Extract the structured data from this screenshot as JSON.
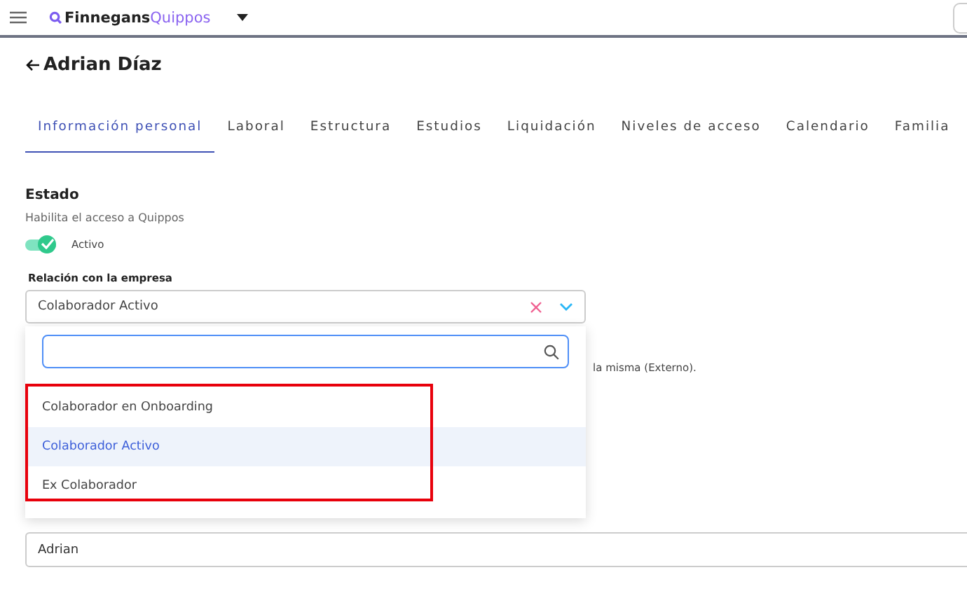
{
  "header": {
    "brand_primary": "Finnegans",
    "brand_secondary": "Quippos"
  },
  "page": {
    "title": "Adrian Díaz"
  },
  "tabs": [
    {
      "label": "Información personal",
      "selected": true
    },
    {
      "label": "Laboral",
      "selected": false
    },
    {
      "label": "Estructura",
      "selected": false
    },
    {
      "label": "Estudios",
      "selected": false
    },
    {
      "label": "Liquidación",
      "selected": false
    },
    {
      "label": "Niveles de acceso",
      "selected": false
    },
    {
      "label": "Calendario",
      "selected": false
    },
    {
      "label": "Familia",
      "selected": false
    }
  ],
  "estado": {
    "heading": "Estado",
    "helper": "Habilita el acceso a Quippos",
    "toggle": {
      "label": "Activo",
      "on": true
    }
  },
  "relacion": {
    "label": "Relación con la empresa",
    "value": "Colaborador Activo",
    "hint_fragment": "la misma (Externo).",
    "dropdown": {
      "open": true,
      "options": [
        {
          "label": "Colaborador en Onboarding",
          "selected": false
        },
        {
          "label": "Colaborador Activo",
          "selected": true
        },
        {
          "label": "Ex Colaborador",
          "selected": false
        }
      ]
    }
  },
  "nombre": {
    "value": "Adrian"
  }
}
